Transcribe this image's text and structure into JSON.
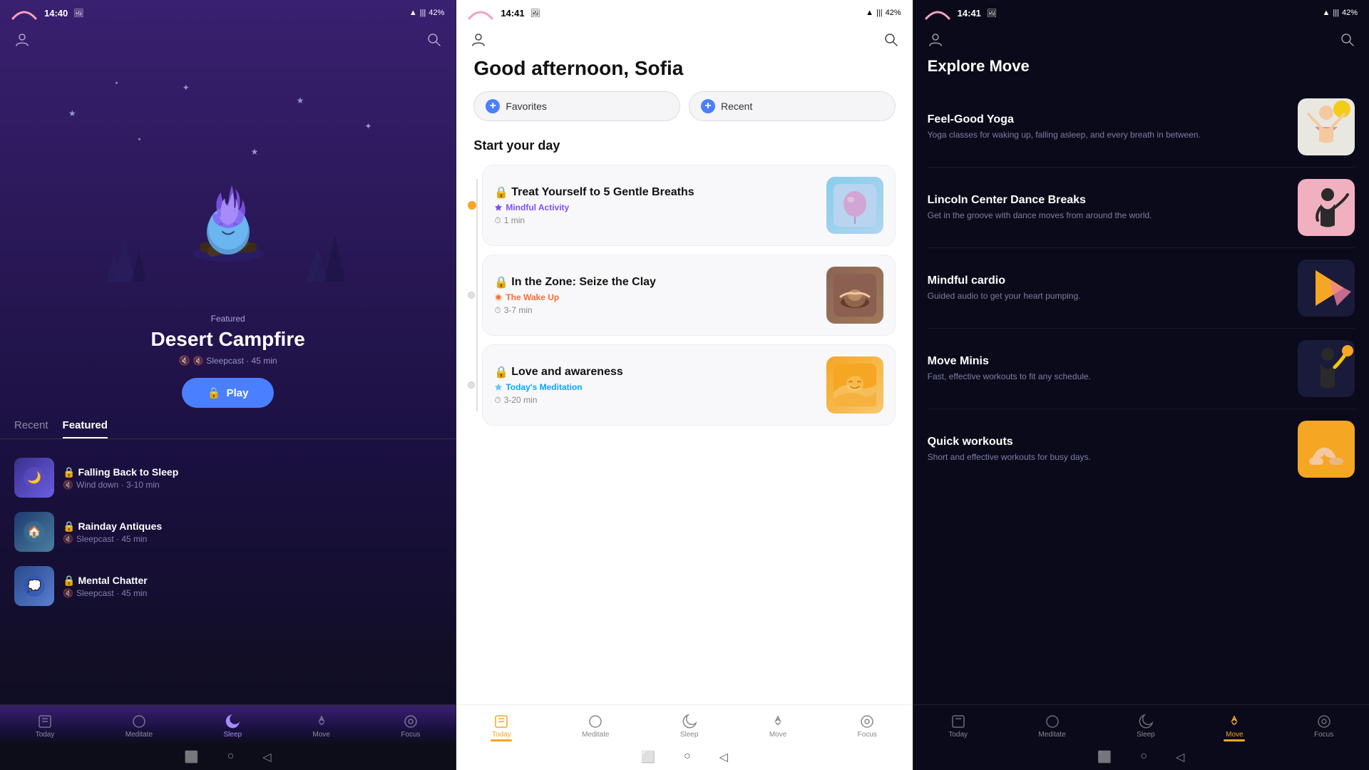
{
  "phone1": {
    "statusBar": {
      "time": "14:40",
      "battery": "42%"
    },
    "hero": {
      "featuredLabel": "Featured",
      "title": "Desert Campfire",
      "subtitle": "🔇 Sleepcast · 45 min",
      "playButton": "Play"
    },
    "tabs": {
      "recent": "Recent",
      "featured": "Featured"
    },
    "activeTab": "Featured",
    "listItems": [
      {
        "title": "Falling Back to Sleep",
        "meta": "Wind down · 3-10 min",
        "type": "sleepcast"
      },
      {
        "title": "Rainday Antiques",
        "meta": "Sleepcast · 45 min",
        "type": "sleepcast"
      },
      {
        "title": "Mental Chatter",
        "meta": "Sleepcast · 45 min",
        "type": "sleepcast"
      }
    ],
    "navItems": [
      {
        "icon": "⬛",
        "label": "Today",
        "active": false
      },
      {
        "icon": "○",
        "label": "Meditate",
        "active": false
      },
      {
        "icon": "🌙",
        "label": "Sleep",
        "active": true
      },
      {
        "icon": "♡",
        "label": "Move",
        "active": false
      },
      {
        "icon": "◎",
        "label": "Focus",
        "active": false
      }
    ]
  },
  "phone2": {
    "statusBar": {
      "time": "14:41",
      "battery": "42%"
    },
    "greeting": "Good afternoon, Sofia",
    "actionButtons": [
      {
        "label": "Favorites"
      },
      {
        "label": "Recent"
      }
    ],
    "sectionTitle": "Start your day",
    "cards": [
      {
        "title": "Treat Yourself to 5 Gentle Breaths",
        "tag": "Mindful Activity",
        "tagColor": "mindful",
        "duration": "1 min",
        "thumbType": "blue"
      },
      {
        "title": "In the Zone: Seize the Clay",
        "tag": "The Wake Up",
        "tagColor": "wake",
        "duration": "3-7 min",
        "thumbType": "clay"
      },
      {
        "title": "Love and awareness",
        "tag": "Today's Meditation",
        "tagColor": "meditation",
        "duration": "3-20 min",
        "thumbType": "awareness"
      }
    ],
    "navItems": [
      {
        "icon": "⬛",
        "label": "Today",
        "active": true
      },
      {
        "icon": "○",
        "label": "Meditate",
        "active": false
      },
      {
        "icon": "🌙",
        "label": "Sleep",
        "active": false
      },
      {
        "icon": "♡",
        "label": "Move",
        "active": false
      },
      {
        "icon": "◎",
        "label": "Focus",
        "active": false
      }
    ]
  },
  "phone3": {
    "statusBar": {
      "time": "14:41",
      "battery": "42%"
    },
    "pageTitle": "Explore Move",
    "cards": [
      {
        "title": "Feel-Good Yoga",
        "subtitle": "Yoga classes for waking up, falling asleep, and every breath in between.",
        "thumbType": "yoga"
      },
      {
        "title": "Lincoln Center Dance Breaks",
        "subtitle": "Get in the groove with dance moves from around the world.",
        "thumbType": "dance"
      },
      {
        "title": "Mindful cardio",
        "subtitle": "Guided audio to get your heart pumping.",
        "thumbType": "cardio"
      },
      {
        "title": "Move Minis",
        "subtitle": "Fast, effective workouts to fit any schedule.",
        "thumbType": "minis"
      },
      {
        "title": "Quick workouts",
        "subtitle": "Short and effective workouts for busy days.",
        "thumbType": "quick"
      }
    ],
    "navItems": [
      {
        "icon": "⬛",
        "label": "Today",
        "active": false
      },
      {
        "icon": "○",
        "label": "Meditate",
        "active": false
      },
      {
        "icon": "🌙",
        "label": "Sleep",
        "active": false
      },
      {
        "icon": "♡",
        "label": "Move",
        "active": true
      },
      {
        "icon": "◎",
        "label": "Focus",
        "active": false
      }
    ]
  }
}
